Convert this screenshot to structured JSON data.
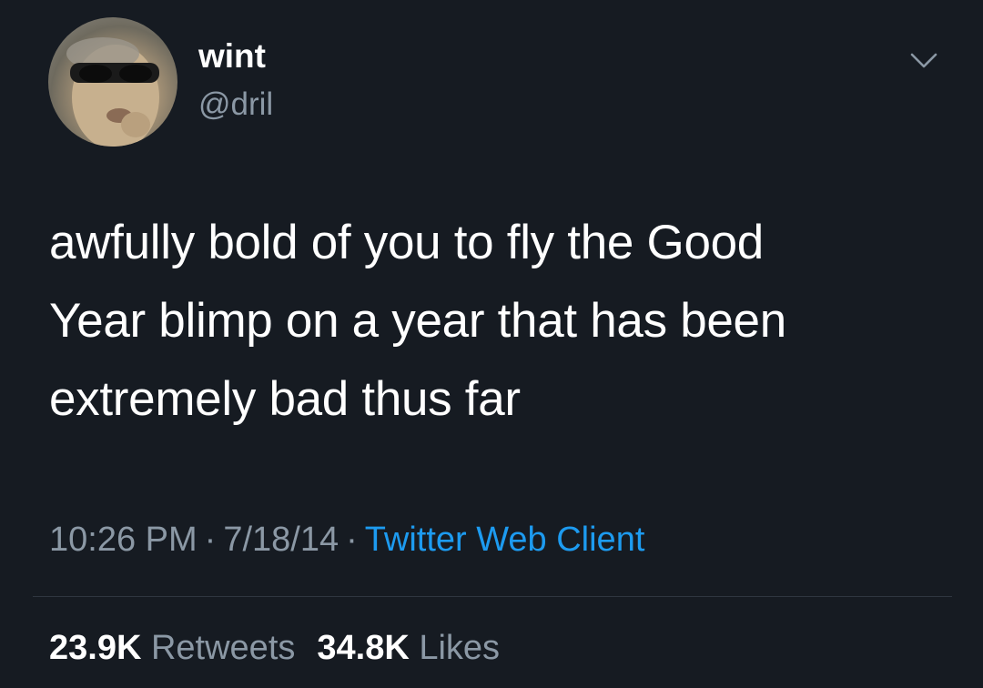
{
  "tweet": {
    "author": {
      "display_name": "wint",
      "handle": "@dril",
      "avatar_icon": "avatar-face-sunglasses"
    },
    "text_lines": [
      "awfully bold of you to fly the Good",
      "Year blimp on a year that has been",
      "extremely bad thus far"
    ],
    "time": "10:26 PM",
    "date": "7/18/14",
    "separator": "·",
    "client": "Twitter Web Client",
    "stats": {
      "retweets_count": "23.9K",
      "retweets_label": "Retweets",
      "likes_count": "34.8K",
      "likes_label": "Likes"
    },
    "menu_icon": "chevron-down-icon"
  },
  "colors": {
    "background": "#161b22",
    "text_primary": "#ffffff",
    "text_secondary": "#8b98a5",
    "link": "#1d9bf0",
    "divider": "#2f3640"
  }
}
